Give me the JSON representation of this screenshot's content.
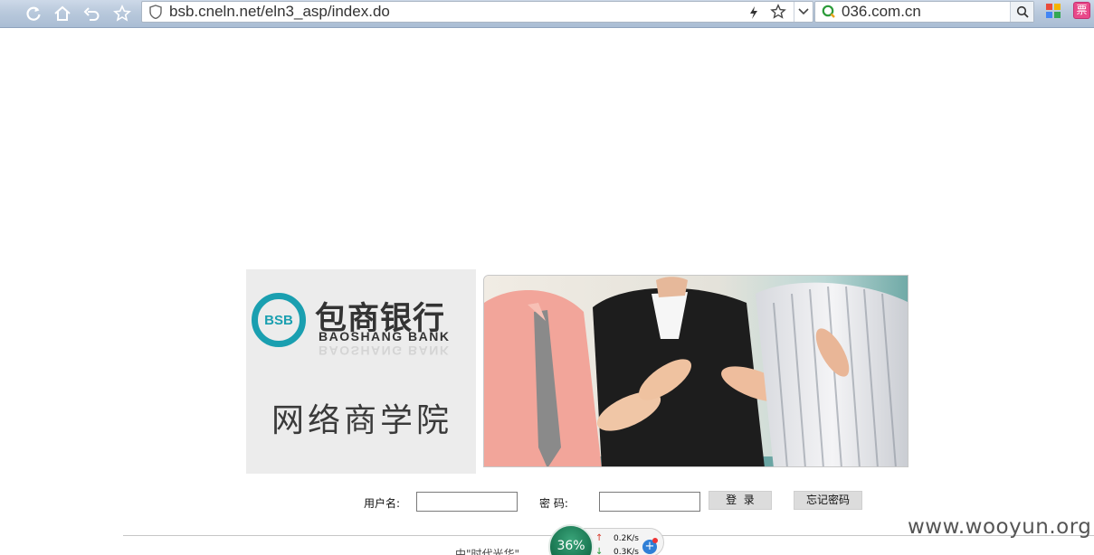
{
  "browser": {
    "url": "bsb.cneln.net/eln3_asp/index.do",
    "search_text": "036.com.cn",
    "ticket_label": "票"
  },
  "logo": {
    "circle_text": "BSB",
    "bank_name_cn": "包商银行",
    "bank_name_en": "BAOSHANG BANK",
    "school_name": "网络商学院"
  },
  "login": {
    "username_label": "用户名:",
    "password_label": "密 码:",
    "username_value": "",
    "password_value": "",
    "login_button": "登  录",
    "forgot_button": "忘记密码"
  },
  "footer": {
    "text": "中\"时代光华\"..."
  },
  "speed_widget": {
    "percent": "36%",
    "upload": "0.2K/s",
    "download": "0.3K/s"
  },
  "watermark": "www.wooyun.org",
  "colors": {
    "brand_teal": "#1a9fb0",
    "toolbar_blue": "#b9c9dc",
    "button_gray": "#dcdcdc"
  }
}
